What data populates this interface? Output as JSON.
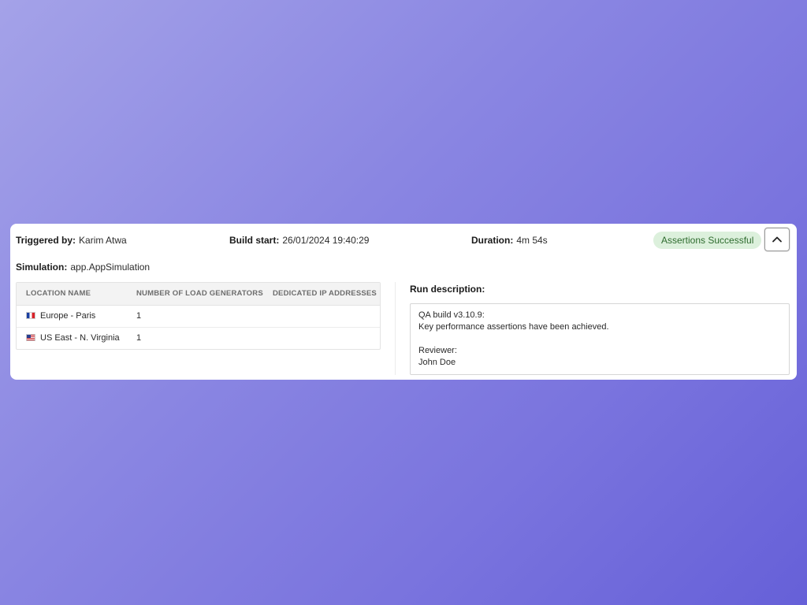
{
  "header": {
    "triggered_by_label": "Triggered by:",
    "triggered_by_value": "Karim Atwa",
    "build_start_label": "Build start:",
    "build_start_value": "26/01/2024 19:40:29",
    "duration_label": "Duration:",
    "duration_value": "4m 54s",
    "status_badge": "Assertions Successful",
    "collapse_icon": "chevron-up-icon"
  },
  "simulation": {
    "label": "Simulation:",
    "value": "app.AppSimulation"
  },
  "locations_table": {
    "columns": [
      "LOCATION NAME",
      "NUMBER OF LOAD GENERATORS",
      "DEDICATED IP ADDRESSES"
    ],
    "rows": [
      {
        "flag": "flag-france-icon",
        "location": "Europe - Paris",
        "load_generators": "1",
        "dedicated_ips": ""
      },
      {
        "flag": "flag-usa-icon",
        "location": "US East - N. Virginia",
        "load_generators": "1",
        "dedicated_ips": ""
      }
    ]
  },
  "run_description": {
    "label": "Run description:",
    "lines": [
      "QA build v3.10.9:",
      "Key performance assertions have been achieved.",
      "",
      "Reviewer:",
      "John Doe"
    ]
  },
  "colors": {
    "badge_bg": "#dcf0dc",
    "badge_text": "#2e6b2e",
    "background_start": "#a4a2e8",
    "background_end": "#6660d8"
  }
}
